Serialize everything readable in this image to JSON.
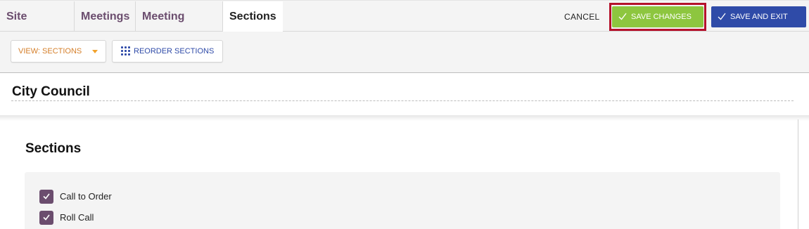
{
  "nav": {
    "breadcrumbs": [
      "Site Settings",
      "Meetings",
      "Meeting Types",
      "Sections"
    ]
  },
  "actions": {
    "cancel": "CANCEL",
    "save_changes": "SAVE CHANGES",
    "save_and_exit": "SAVE AND EXIT"
  },
  "toolbar": {
    "view_label": "VIEW: SECTIONS",
    "reorder_label": "REORDER SECTIONS"
  },
  "page": {
    "title": "City Council"
  },
  "sections": {
    "heading": "Sections",
    "items": [
      {
        "label": "Call to Order",
        "checked": true
      },
      {
        "label": "Roll Call",
        "checked": true
      }
    ]
  },
  "colors": {
    "breadcrumb": "#6b4d6e",
    "save_green": "#8dc63f",
    "save_exit_blue": "#2f4ba8",
    "highlight_outline": "#b5122b",
    "view_orange": "#d57f2a",
    "checkbox_purple": "#6b4d6e"
  },
  "icons": {
    "save_changes": "check-icon",
    "save_and_exit": "check-icon",
    "view_dropdown": "caret-down-icon",
    "reorder": "grid-dots-icon"
  }
}
